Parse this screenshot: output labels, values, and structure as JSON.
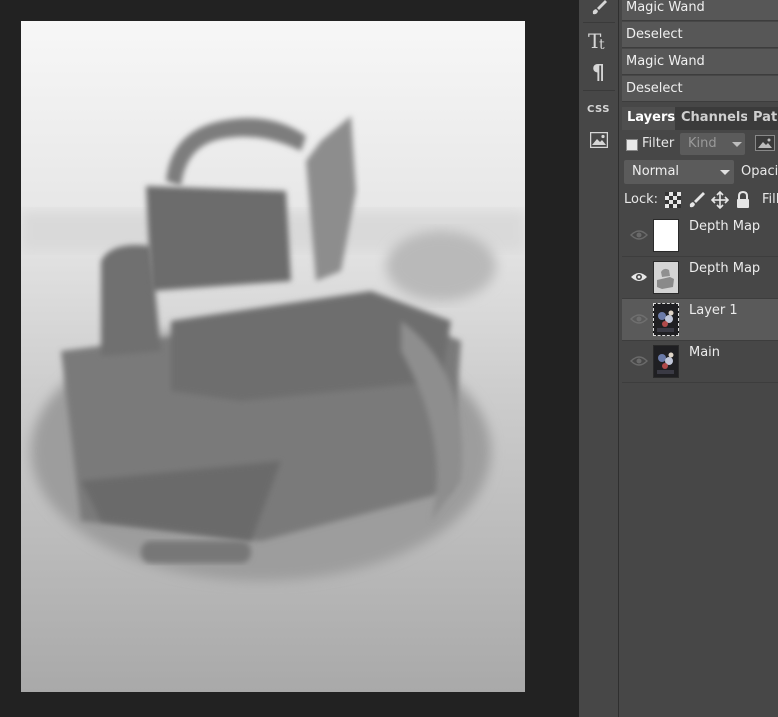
{
  "history": {
    "items": [
      {
        "label": "Magic Wand"
      },
      {
        "label": "Deselect"
      },
      {
        "label": "Magic Wand"
      },
      {
        "label": "Deselect"
      }
    ]
  },
  "tabs": [
    {
      "label": "Layers",
      "active": true
    },
    {
      "label": "Channels",
      "active": false
    },
    {
      "label": "Path",
      "active": false
    }
  ],
  "filter": {
    "label": "Filter",
    "kind_value": "Kind"
  },
  "blend": {
    "mode": "Normal",
    "opacity_label": "Opacit"
  },
  "lock": {
    "label": "Lock:",
    "fill_label": "Fill"
  },
  "layers": [
    {
      "name": "Depth Map",
      "visible": false,
      "selected": false,
      "thumb": "white"
    },
    {
      "name": "Depth Map",
      "visible": true,
      "selected": false,
      "thumb": "depth"
    },
    {
      "name": "Layer 1",
      "visible": false,
      "selected": true,
      "thumb": "photo"
    },
    {
      "name": "Main",
      "visible": false,
      "selected": false,
      "thumb": "photo"
    }
  ],
  "tools": [
    {
      "icon": "brush-icon"
    },
    {
      "icon": "text-icon"
    },
    {
      "icon": "paragraph-icon"
    },
    {
      "icon": "css-icon",
      "label": "CSS"
    },
    {
      "icon": "image-icon"
    }
  ]
}
